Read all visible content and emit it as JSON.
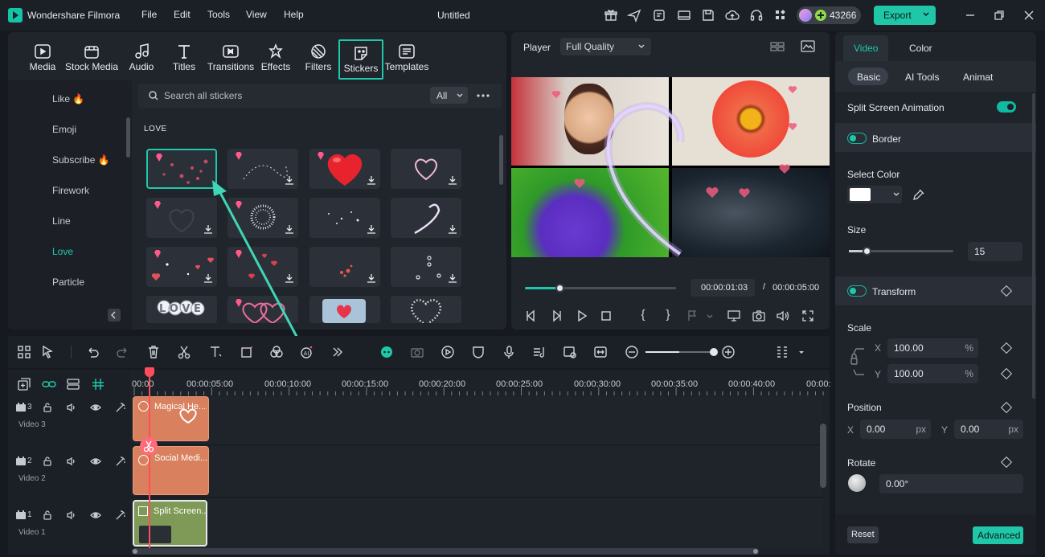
{
  "app": {
    "title": "Wondershare Filmora",
    "doc_title": "Untitled",
    "credits": "43266",
    "export_label": "Export"
  },
  "menu": [
    "File",
    "Edit",
    "Tools",
    "View",
    "Help"
  ],
  "media_tabs": [
    "Media",
    "Stock Media",
    "Audio",
    "Titles",
    "Transitions",
    "Effects",
    "Filters",
    "Stickers",
    "Templates"
  ],
  "categories": [
    "Like",
    "Emoji",
    "Subscribe",
    "Firework",
    "Line",
    "Love",
    "Particle"
  ],
  "active_category": "Love",
  "search": {
    "placeholder": "Search all stickers",
    "filter": "All"
  },
  "section_title": "LOVE",
  "player": {
    "label": "Player",
    "quality": "Full Quality",
    "current_time": "00:00:01:03",
    "separator": "/",
    "total_time": "00:00:05:00",
    "progress": 0.23
  },
  "timeline": {
    "ruler": [
      "00:00",
      "00:00:05:00",
      "00:00:10:00",
      "00:00:15:00",
      "00:00:20:00",
      "00:00:25:00",
      "00:00:30:00",
      "00:00:35:00",
      "00:00:40:00",
      "00:00:"
    ],
    "tracks": [
      {
        "number": "3",
        "name": "Video 3",
        "clip": "Magical He..."
      },
      {
        "number": "2",
        "name": "Video 2",
        "clip": "Social Medi..."
      },
      {
        "number": "1",
        "name": "Video 1",
        "clip": "Split Screen..."
      }
    ],
    "zoom_level": 0.5
  },
  "props": {
    "tabs": [
      "Video",
      "Color"
    ],
    "subtabs": [
      "Basic",
      "AI Tools",
      "Animat"
    ],
    "split_screen_animation": "Split Screen Animation",
    "border": "Border",
    "select_color": "Select Color",
    "size_label": "Size",
    "size_value": "15",
    "transform": "Transform",
    "scale": "Scale",
    "scale_x_label": "X",
    "scale_x": "100.00",
    "scale_y_label": "Y",
    "scale_y": "100.00",
    "percent": "%",
    "position": "Position",
    "pos_x_label": "X",
    "pos_x": "0.00",
    "pos_y_label": "Y",
    "pos_y": "0.00",
    "px": "px",
    "rotate": "Rotate",
    "rotate_value": "0.00°",
    "reset": "Reset",
    "advanced": "Advanced"
  },
  "colors": {
    "accent": "#12b8a0",
    "export": "#1fc7a8",
    "playhead": "#ff4d5e",
    "clip_orange": "#d9805e",
    "clip_green": "#7e9a56"
  }
}
